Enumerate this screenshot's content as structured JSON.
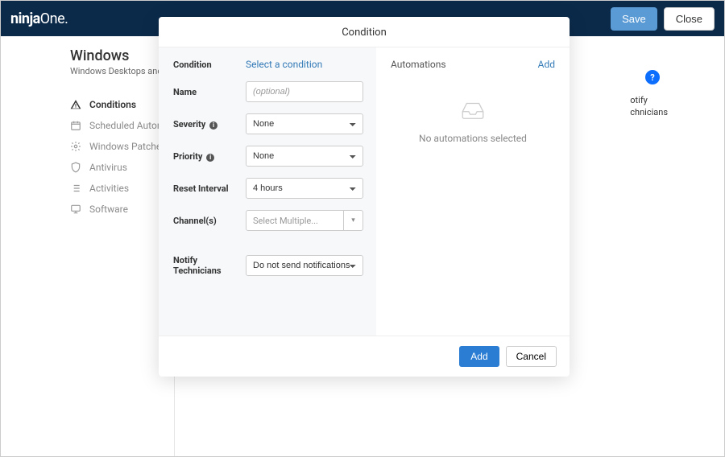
{
  "topbar": {
    "logo_bold": "ninja",
    "logo_light": "One.",
    "save": "Save",
    "close": "Close"
  },
  "page": {
    "title": "Windows",
    "subtitle": "Windows Desktops and Laptops"
  },
  "sidebar": {
    "items": [
      {
        "icon": "warning-icon",
        "label": "Conditions",
        "active": true
      },
      {
        "icon": "calendar-icon",
        "label": "Scheduled Automations",
        "active": false
      },
      {
        "icon": "gear-icon",
        "label": "Windows Patches",
        "active": false
      },
      {
        "icon": "shield-icon",
        "label": "Antivirus",
        "active": false
      },
      {
        "icon": "list-icon",
        "label": "Activities",
        "active": false
      },
      {
        "icon": "monitor-icon",
        "label": "Software",
        "active": false
      }
    ]
  },
  "help_badge": "?",
  "peek": {
    "line1": "otify",
    "line2": "chnicians"
  },
  "modal": {
    "title": "Condition",
    "labels": {
      "condition": "Condition",
      "name": "Name",
      "severity": "Severity",
      "priority": "Priority",
      "reset_interval": "Reset Interval",
      "channels": "Channel(s)",
      "notify": "Notify Technicians"
    },
    "condition_link": "Select a condition",
    "name_placeholder": "(optional)",
    "severity_value": "None",
    "priority_value": "None",
    "reset_interval_value": "4 hours",
    "channels_placeholder": "Select Multiple...",
    "notify_value": "Do not send notifications",
    "automations": {
      "heading": "Automations",
      "add": "Add",
      "empty": "No automations selected"
    },
    "footer": {
      "add": "Add",
      "cancel": "Cancel"
    }
  }
}
